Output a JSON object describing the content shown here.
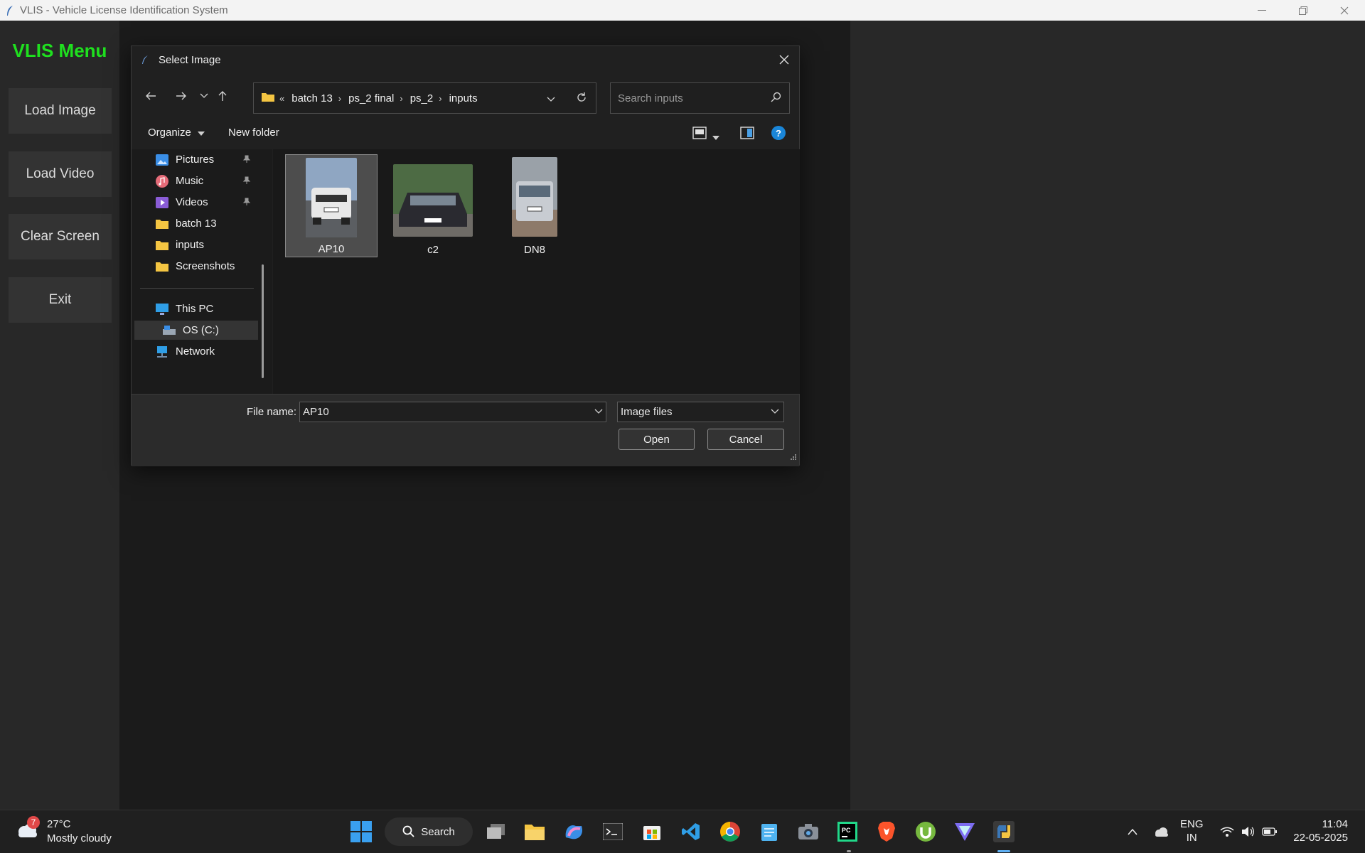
{
  "window": {
    "title": "VLIS - Vehicle License Identification System"
  },
  "sidebar": {
    "title": "VLIS Menu",
    "buttons": [
      "Load Image",
      "Load Video",
      "Clear Screen",
      "Exit"
    ],
    "title_color": "#1fe01f"
  },
  "dialog": {
    "title": "Select Image",
    "breadcrumb": [
      "batch 13",
      "ps_2 final",
      "ps_2",
      "inputs"
    ],
    "search_placeholder": "Search inputs",
    "toolbar": {
      "organize": "Organize",
      "new_folder": "New folder"
    },
    "nav_items": [
      {
        "label": "Pictures",
        "icon": "pictures-icon",
        "pinned": true
      },
      {
        "label": "Music",
        "icon": "music-icon",
        "pinned": true
      },
      {
        "label": "Videos",
        "icon": "videos-icon",
        "pinned": true
      },
      {
        "label": "batch 13",
        "icon": "folder-icon",
        "pinned": false
      },
      {
        "label": "inputs",
        "icon": "folder-icon",
        "pinned": false
      },
      {
        "label": "Screenshots",
        "icon": "folder-icon",
        "pinned": false
      },
      {
        "label": "This PC",
        "icon": "computer-icon",
        "pinned": false
      },
      {
        "label": "OS (C:)",
        "icon": "drive-icon",
        "pinned": false,
        "selected": true
      },
      {
        "label": "Network",
        "icon": "network-icon",
        "pinned": false
      }
    ],
    "files": [
      {
        "name": "AP10",
        "selected": true
      },
      {
        "name": "c2",
        "selected": false
      },
      {
        "name": "DN8",
        "selected": false
      }
    ],
    "file_name_label": "File name:",
    "file_name_value": "AP10",
    "file_type": "Image files",
    "open_label": "Open",
    "cancel_label": "Cancel"
  },
  "taskbar": {
    "weather": {
      "temp": "27°C",
      "condition": "Mostly cloudy",
      "badge": "7"
    },
    "search_label": "Search",
    "lang": "ENG",
    "region": "IN",
    "time": "11:04",
    "date": "22-05-2025"
  }
}
